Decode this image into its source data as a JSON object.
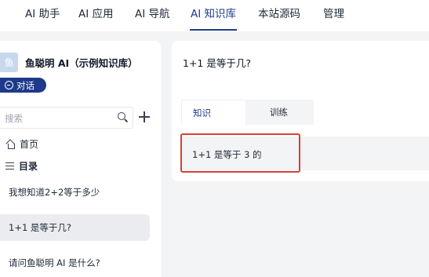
{
  "nav": {
    "items": [
      "AI 助手",
      "AI 应用",
      "AI 导航",
      "AI 知识库",
      "本站源码",
      "管理"
    ],
    "active_index": 3
  },
  "sidebar": {
    "avatar_char": "鱼",
    "kb_title": "鱼聪明 AI（示例知识库）",
    "chat_button": "对话",
    "search_placeholder": "搜索",
    "home_label": "首页",
    "dir_label": "目录",
    "docs": [
      "我想知道2+2等于多少",
      "1+1 是等于几?",
      "请问鱼聪明 AI 是什么?"
    ],
    "active_doc_index": 1
  },
  "main": {
    "question": "1+1 是等于几?",
    "tabs": [
      "知识",
      "训练"
    ],
    "active_tab_index": 0,
    "answer": "1+1 是等于 3 的"
  },
  "colors": {
    "accent": "#1e3a8a",
    "highlight_border": "#d93f35",
    "avatar_bg": "#c7d7ee"
  }
}
